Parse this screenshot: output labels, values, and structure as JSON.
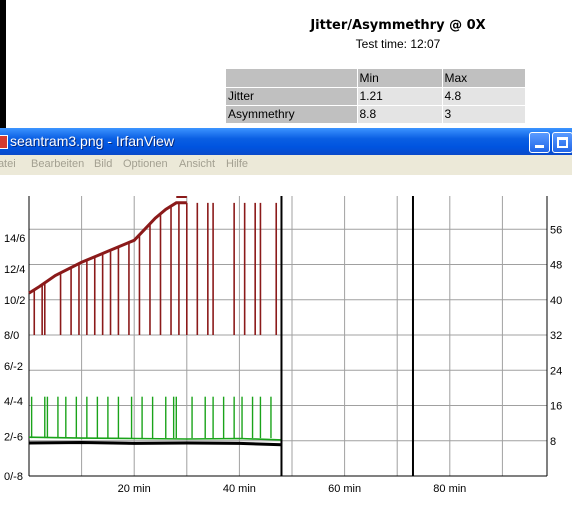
{
  "report": {
    "title": "Jitter/Asymmethry @ 0X",
    "test_time": "Test time: 12:07",
    "table": {
      "headers": [
        "",
        "Min",
        "Max"
      ],
      "rows": [
        {
          "label": "Jitter",
          "min": "1.21",
          "max": "4.8"
        },
        {
          "label": "Asymmethry",
          "min": "8.8",
          "max": "3"
        }
      ]
    }
  },
  "window": {
    "title": "seantram3.png - IrfanView",
    "icon": "irfanview-icon",
    "buttons": {
      "minimize": "minimize-icon",
      "maximize": "maximize-icon"
    },
    "menu": [
      "Datei",
      "Bearbeiten",
      "Bild",
      "Optionen",
      "Ansicht",
      "Hilfe"
    ]
  },
  "colors": {
    "jitter_series": "#8b1a1a",
    "asym_series": "#1aa31a",
    "baseline": "#000000",
    "grid": "#a0a0a0",
    "titlebar": "#0054e3"
  },
  "chart_data": {
    "type": "line",
    "xlim": [
      0,
      95
    ],
    "x_ticks": [
      "20 min",
      "40 min",
      "60 min",
      "80 min"
    ],
    "left_ticks": [
      "14/6",
      "12/4",
      "10/2",
      "8/0",
      "6/-2",
      "4/-4",
      "2/-6",
      "0/-8"
    ],
    "right_ticks": [
      "56",
      "48",
      "40",
      "32",
      "24",
      "16",
      "8"
    ],
    "ylim_right": [
      0,
      64
    ],
    "data_end_min": 48,
    "vertical_markers_min": [
      48,
      73
    ],
    "series": [
      {
        "color": "#8b1a1a",
        "points": [
          [
            0,
            41.5
          ],
          [
            2,
            43
          ],
          [
            5,
            45.5
          ],
          [
            10,
            48.5
          ],
          [
            15,
            51
          ],
          [
            20,
            53.5
          ],
          [
            22,
            56
          ],
          [
            24,
            58.5
          ],
          [
            26,
            60.5
          ],
          [
            28,
            62
          ],
          [
            30,
            62
          ]
        ],
        "spike_minutes": [
          1,
          2.5,
          3,
          6,
          8,
          9.5,
          11,
          12.5,
          14,
          15.5,
          17,
          19,
          21,
          23,
          25,
          27,
          28.5,
          30,
          32,
          34,
          35,
          39,
          41,
          43,
          44,
          47
        ]
      },
      {
        "color": "#1aa31a",
        "points": [
          [
            0,
            8.8
          ],
          [
            10,
            8.6
          ],
          [
            20,
            8.5
          ],
          [
            30,
            8.4
          ],
          [
            40,
            8.5
          ],
          [
            48,
            8.2
          ]
        ],
        "spike_minutes": [
          0.5,
          3,
          3.5,
          5.5,
          7,
          9,
          11,
          13,
          15,
          17,
          19.5,
          21.5,
          23.5,
          26,
          27.5,
          28,
          31,
          33.5,
          35,
          37,
          39,
          40.5,
          42.5,
          44,
          46
        ]
      },
      {
        "color": "#000000",
        "points": [
          [
            0,
            7.5
          ],
          [
            10,
            7.6
          ],
          [
            20,
            7.4
          ],
          [
            30,
            7.5
          ],
          [
            40,
            7.4
          ],
          [
            48,
            7.1
          ]
        ]
      }
    ]
  }
}
